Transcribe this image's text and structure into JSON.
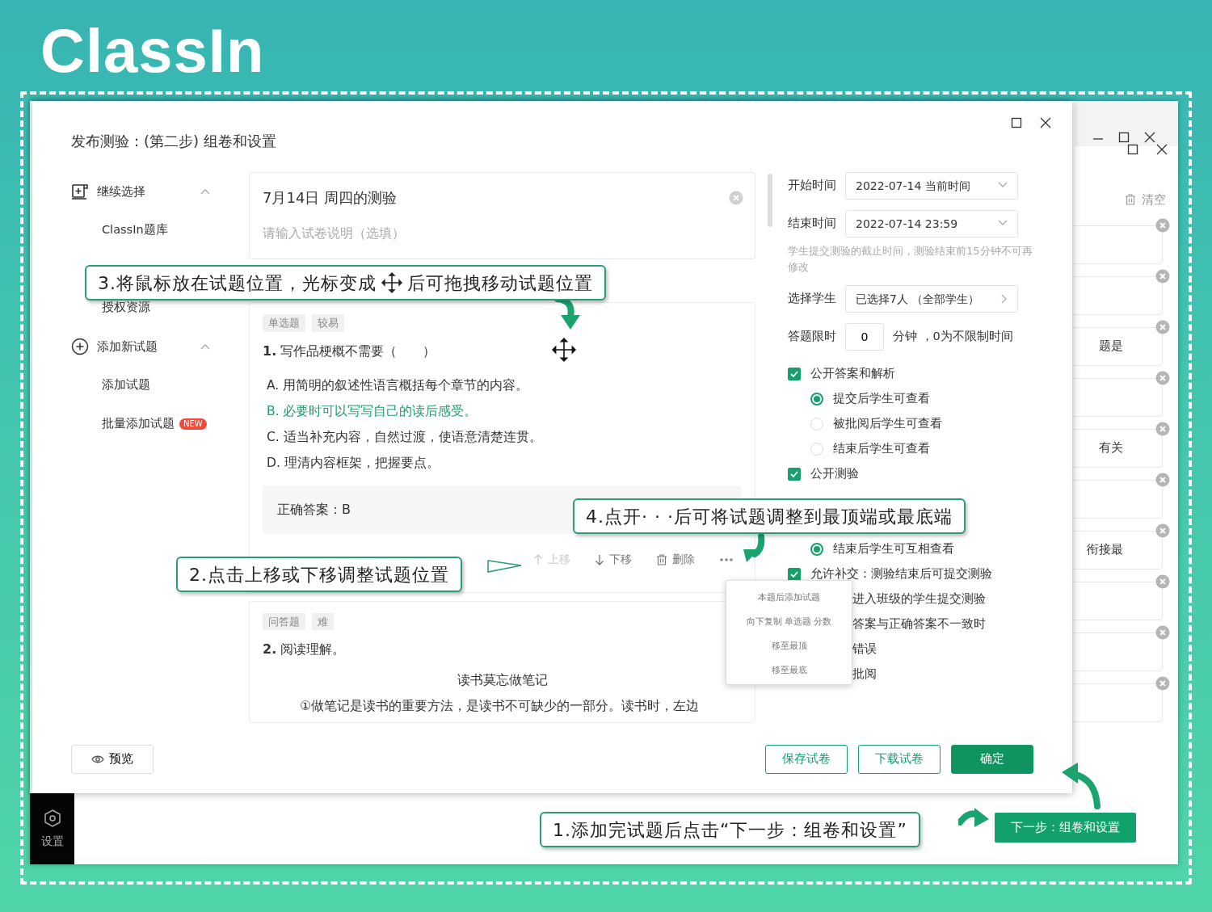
{
  "brand": {
    "logo": "ClassIn"
  },
  "back_window": {
    "clear_label": "清空",
    "cards": [
      {
        "kind": "empty"
      },
      {
        "kind": "empty"
      },
      {
        "kind": "text",
        "text": "题是"
      },
      {
        "kind": "empty"
      },
      {
        "kind": "text",
        "text": "有关"
      },
      {
        "kind": "empty"
      },
      {
        "kind": "text",
        "text": "衔接最"
      },
      {
        "kind": "empty"
      },
      {
        "kind": "empty"
      },
      {
        "kind": "empty"
      }
    ],
    "sidebar": {
      "label": "设置"
    },
    "next_button": "下一步：组卷和设置"
  },
  "dialog": {
    "title": "发布测验：(第二步) 组卷和设置",
    "nav": [
      {
        "kind": "import",
        "label": "继续选择",
        "expanded": true,
        "children": [
          {
            "label": "ClassIn题库"
          },
          {
            "label": "授权资源"
          }
        ]
      },
      {
        "kind": "add",
        "label": "添加新试题",
        "expanded": true,
        "children": [
          {
            "label": "添加试题"
          },
          {
            "label": "批量添加试题",
            "badge": "NEW"
          }
        ]
      }
    ],
    "paper": {
      "title": "7月14日 周四的测验",
      "description_placeholder": "请输入试卷说明（选填）"
    },
    "questions": [
      {
        "tags": [
          "单选题",
          "较易"
        ],
        "number": "1.",
        "stem": "写作品梗概不需要（　　）",
        "options": [
          {
            "text": "A. 用简明的叙述性语言概括每个章节的内容。",
            "correct": false
          },
          {
            "text": "B. 必要时可以写写自己的读后感受。",
            "correct": true
          },
          {
            "text": "C. 适当补充内容，自然过渡，使语意清楚连贯。",
            "correct": false
          },
          {
            "text": "D. 理清内容框架，把握要点。",
            "correct": false
          }
        ],
        "answer": "正确答案：B",
        "actions": [
          {
            "kind": "up",
            "label": "上移",
            "disabled": true
          },
          {
            "kind": "down",
            "label": "下移",
            "disabled": false
          },
          {
            "kind": "delete",
            "label": "删除",
            "disabled": false
          },
          {
            "kind": "more"
          }
        ]
      },
      {
        "tags": [
          "问答题",
          "难"
        ],
        "number": "2.",
        "stem": "阅读理解。",
        "passage_title": "读书莫忘做笔记",
        "passage": "①做笔记是读书的重要方法，是读书不可缺少的一部分。读书时，左边"
      }
    ],
    "settings": {
      "start": {
        "label": "开始时间",
        "value": "2022-07-14 当前时间"
      },
      "end": {
        "label": "结束时间",
        "value": "2022-07-14 23:59",
        "hint": "学生提交测验的截止时间，测验结束前15分钟不可再修改"
      },
      "students": {
        "label": "选择学生",
        "value": "已选择7人 （全部学生）"
      },
      "time_limit": {
        "label": "答题限时",
        "value": "0",
        "unit": "分钟 ，0为不限制时间"
      },
      "options": [
        {
          "kind": "checkbox",
          "label": "公开答案和解析",
          "checked": true
        },
        {
          "kind": "radio",
          "label": "提交后学生可查看",
          "selected": true
        },
        {
          "kind": "radio",
          "label": "被批阅后学生可查看",
          "selected": false
        },
        {
          "kind": "radio",
          "label": "结束后学生可查看",
          "selected": false
        },
        {
          "kind": "checkbox",
          "label": "公开测验",
          "checked": true
        },
        {
          "kind": "radio",
          "label": "结束后学生可互相查看",
          "selected": true
        },
        {
          "kind": "checkbox",
          "label": "允许补交：测验结束后可提交测验",
          "checked": true
        },
        {
          "kind": "text",
          "label": "进入班级的学生提交测验"
        },
        {
          "kind": "text",
          "label": "答案与正确答案不一致时"
        },
        {
          "kind": "text",
          "label": "错误"
        },
        {
          "kind": "text",
          "label": "批阅"
        }
      ]
    },
    "footer": {
      "preview": "预览",
      "buttons": [
        {
          "label": "保存试卷",
          "primary": false
        },
        {
          "label": "下载试卷",
          "primary": false
        },
        {
          "label": "确定",
          "primary": true
        }
      ]
    }
  },
  "menu": {
    "items": [
      "本题后添加试题",
      "向下复制 单选题 分数",
      "移至最顶",
      "移至最底"
    ]
  },
  "callouts": [
    {
      "text": "3.将鼠标放在试题位置，光标变成",
      "text_after": "后可拖拽移动试题位置"
    },
    {
      "text": "4.点开· · ·后可将试题调整到最顶端或最底端"
    },
    {
      "text": "2.点击上移或下移调整试题位置"
    },
    {
      "text": "1.添加完试题后点击“下一步：组卷和设置”"
    }
  ]
}
